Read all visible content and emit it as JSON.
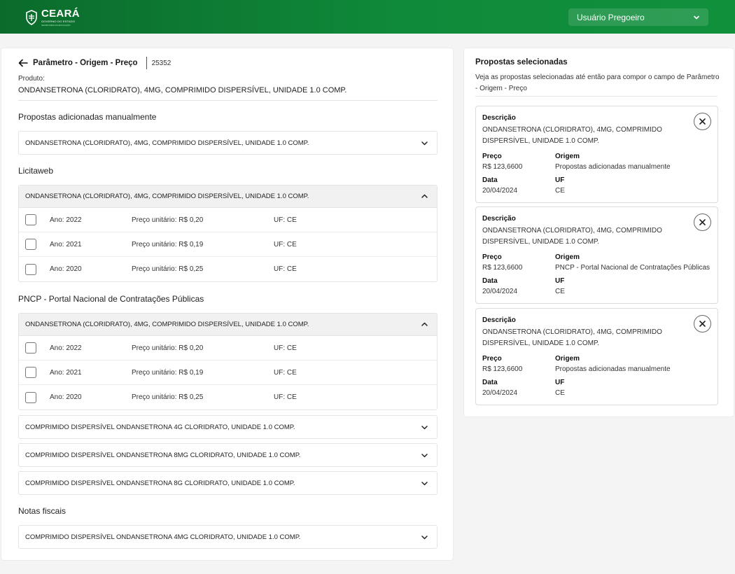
{
  "header": {
    "brand": "CEARÁ",
    "brand_sub": "GOVERNO DO ESTADO",
    "brand_sub2": "SECRETARIA DA EDUCAÇÃO",
    "user_menu": "Usuário Pregoeiro"
  },
  "main": {
    "title": "Parâmetro - Origem - Preço",
    "code": "25352",
    "produto_label": "Produto:",
    "produto_value": "ONDANSETRONA (CLORIDRATO), 4MG, COMPRIMIDO DISPERSÍVEL, UNIDADE 1.0 COMP.",
    "sections": [
      {
        "title": "Propostas adicionadas manualmente",
        "accordions": [
          {
            "label": "ONDANSETRONA (CLORIDRATO), 4MG, COMPRIMIDO DISPERSÍVEL, UNIDADE 1.0 COMP.",
            "open": false,
            "rows": []
          }
        ]
      },
      {
        "title": "Licitaweb",
        "accordions": [
          {
            "label": "ONDANSETRONA (CLORIDRATO), 4MG, COMPRIMIDO DISPERSÍVEL, UNIDADE 1.0 COMP.",
            "open": true,
            "rows": [
              {
                "ano": "Ano: 2022",
                "preco": "Preço unitário: R$ 0,20",
                "uf": "UF: CE"
              },
              {
                "ano": "Ano: 2021",
                "preco": "Preço unitário: R$ 0,19",
                "uf": "UF: CE"
              },
              {
                "ano": "Ano: 2020",
                "preco": "Preço unitário: R$ 0,25",
                "uf": "UF: CE"
              }
            ]
          }
        ]
      },
      {
        "title": "PNCP - Portal Nacional de Contratações Públicas",
        "accordions": [
          {
            "label": "ONDANSETRONA (CLORIDRATO), 4MG, COMPRIMIDO DISPERSÍVEL, UNIDADE 1.0 COMP.",
            "open": true,
            "rows": [
              {
                "ano": "Ano: 2022",
                "preco": "Preço unitário: R$ 0,20",
                "uf": "UF: CE"
              },
              {
                "ano": "Ano: 2021",
                "preco": "Preço unitário: R$ 0,19",
                "uf": "UF: CE"
              },
              {
                "ano": "Ano: 2020",
                "preco": "Preço unitário: R$ 0,25",
                "uf": "UF: CE"
              }
            ]
          },
          {
            "label": "COMPRIMIDO DISPERSÍVEL ONDANSETRONA 4G CLORIDRATO, UNIDADE 1.0 COMP.",
            "open": false,
            "rows": []
          },
          {
            "label": "COMPRIMIDO DISPERSÍVEL ONDANSETRONA 8MG CLORIDRATO, UNIDADE 1.0 COMP.",
            "open": false,
            "rows": []
          },
          {
            "label": "COMPRIMIDO DISPERSÍVEL ONDANSETRONA 8G CLORIDRATO, UNIDADE 1.0 COMP.",
            "open": false,
            "rows": []
          }
        ]
      },
      {
        "title": "Notas fiscais",
        "accordions": [
          {
            "label": "COMPRIMIDO DISPERSÍVEL ONDANSETRONA 4MG CLORIDRATO, UNIDADE 1.0 COMP.",
            "open": false,
            "rows": []
          }
        ]
      }
    ]
  },
  "selected": {
    "title": "Propostas selecionadas",
    "description": "Veja as propostas selecionadas até então para compor o campo de Parâmetro - Origem - Preço",
    "labels": {
      "descricao": "Descrição",
      "preco": "Preço",
      "origem": "Origem",
      "data": "Data",
      "uf": "UF"
    },
    "cards": [
      {
        "descricao": "ONDANSETRONA (CLORIDRATO), 4MG, COMPRIMIDO DISPERSÍVEL, UNIDADE 1.0 COMP.",
        "preco": "R$ 123,6600",
        "origem": "Propostas adicionadas manualmente",
        "data": "20/04/2024",
        "uf": "CE"
      },
      {
        "descricao": "ONDANSETRONA (CLORIDRATO), 4MG, COMPRIMIDO DISPERSÍVEL, UNIDADE 1.0 COMP.",
        "preco": "R$ 123,6600",
        "origem": "PNCP - Portal Nacional de Contratações Públicas",
        "data": "20/04/2024",
        "uf": "CE"
      },
      {
        "descricao": "ONDANSETRONA (CLORIDRATO), 4MG, COMPRIMIDO DISPERSÍVEL, UNIDADE 1.0 COMP.",
        "preco": "R$ 123,6600",
        "origem": "Propostas adicionadas manualmente",
        "data": "20/04/2024",
        "uf": "CE"
      }
    ]
  }
}
